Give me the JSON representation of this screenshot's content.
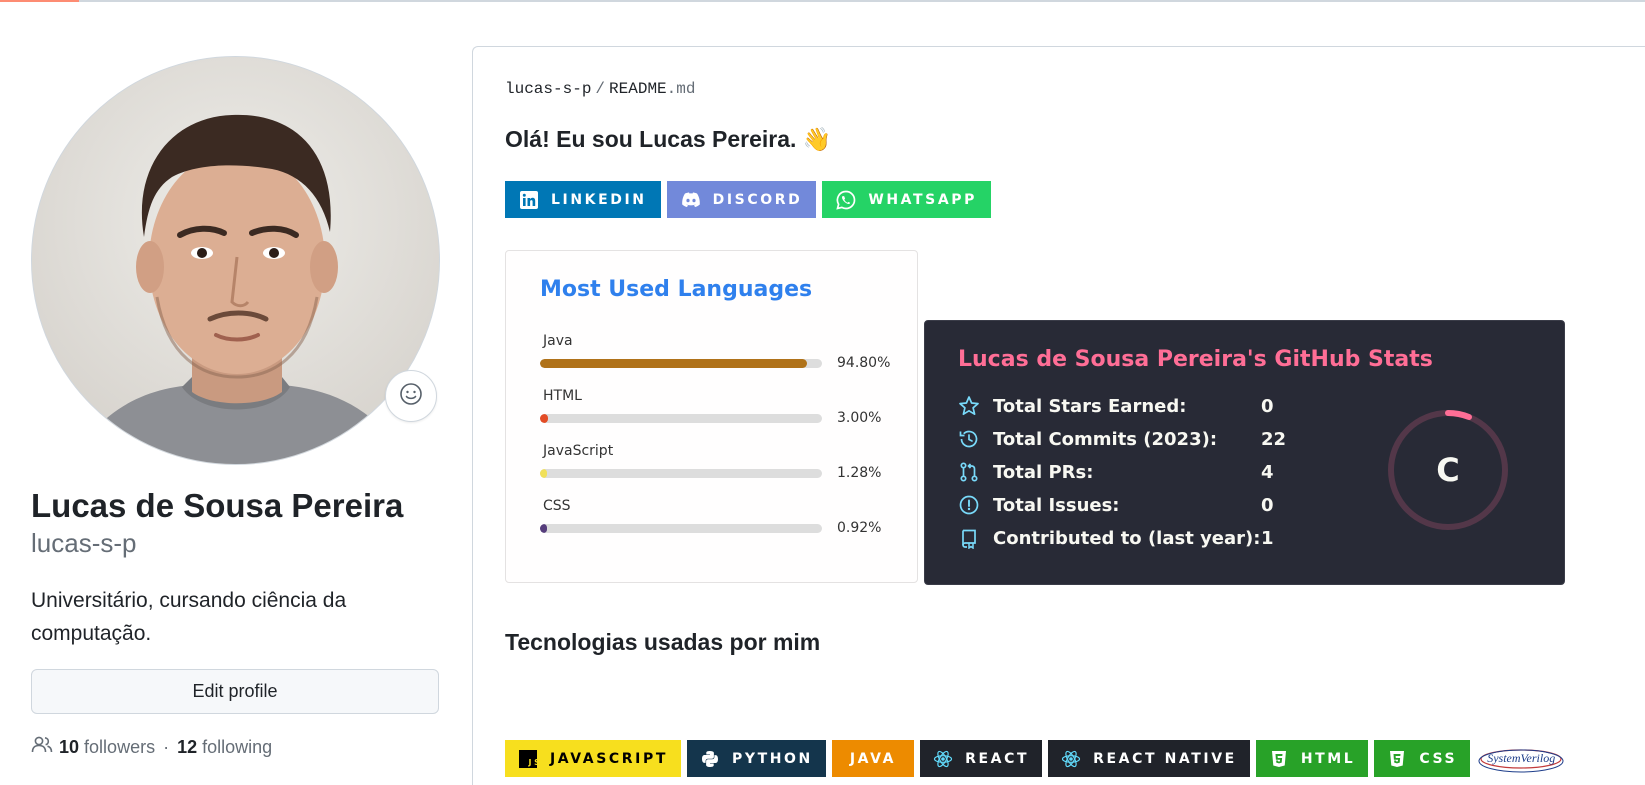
{
  "profile": {
    "full_name": "Lucas de Sousa Pereira",
    "username": "lucas-s-p",
    "bio": "Universitário, cursando ciência da computação.",
    "edit_button": "Edit profile",
    "followers_count": "10",
    "followers_label": "followers",
    "separator": "·",
    "following_count": "12",
    "following_label": "following"
  },
  "readme": {
    "owner": "lucas-s-p",
    "file_name": "README",
    "file_ext": ".md",
    "greeting": "Olá! Eu sou Lucas Pereira. 👋",
    "social_badges": [
      {
        "label": "LINKEDIN",
        "color": "#0077b5",
        "icon": "linkedin-icon"
      },
      {
        "label": "DISCORD",
        "color": "#7289da",
        "icon": "discord-icon"
      },
      {
        "label": "WHATSAPP",
        "color": "#25d366",
        "icon": "whatsapp-icon"
      }
    ],
    "tech_heading": "Tecnologias usadas por mim",
    "tech_badges": [
      {
        "label": "JAVASCRIPT",
        "color": "#f7df1e",
        "text_color": "#000000",
        "icon": "javascript-icon"
      },
      {
        "label": "PYTHON",
        "color": "#14354c",
        "text_color": "#ffffff",
        "icon": "python-icon"
      },
      {
        "label": "JAVA",
        "color": "#ed8b00",
        "text_color": "#ffffff",
        "icon": "java-icon"
      },
      {
        "label": "REACT",
        "color": "#20232a",
        "text_color": "#ffffff",
        "icon": "react-icon"
      },
      {
        "label": "REACT NATIVE",
        "color": "#20232a",
        "text_color": "#ffffff",
        "icon": "react-icon"
      },
      {
        "label": "HTML",
        "color": "#28a228",
        "text_color": "#ffffff",
        "icon": "html5-icon"
      },
      {
        "label": "CSS",
        "color": "#28a228",
        "text_color": "#ffffff",
        "icon": "css3-icon"
      }
    ],
    "systemverilog_logo": "SystemVerilog"
  },
  "languages_card": {
    "title": "Most Used Languages",
    "title_color": "#2f80ed",
    "items": [
      {
        "name": "Java",
        "percent": 94.8,
        "label": "94.80%",
        "color": "#b07219"
      },
      {
        "name": "HTML",
        "percent": 3.0,
        "label": "3.00%",
        "color": "#e34c26"
      },
      {
        "name": "JavaScript",
        "percent": 1.28,
        "label": "1.28%",
        "color": "#f1e05a"
      },
      {
        "name": "CSS",
        "percent": 0.92,
        "label": "0.92%",
        "color": "#563d7c"
      }
    ]
  },
  "stats_card": {
    "title": "Lucas de Sousa Pereira's GitHub Stats",
    "title_color": "#ff6e96",
    "icon_color": "#79dafa",
    "rows": [
      {
        "label": "Total Stars Earned:",
        "value": "0",
        "icon": "star-icon"
      },
      {
        "label": "Total Commits (2023):",
        "value": "22",
        "icon": "history-icon"
      },
      {
        "label": "Total PRs:",
        "value": "4",
        "icon": "pull-request-icon"
      },
      {
        "label": "Total Issues:",
        "value": "0",
        "icon": "issue-icon"
      },
      {
        "label": "Contributed to (last year):",
        "value": "1",
        "icon": "repo-icon"
      }
    ],
    "rank": "C",
    "rank_progress": 0.06
  }
}
